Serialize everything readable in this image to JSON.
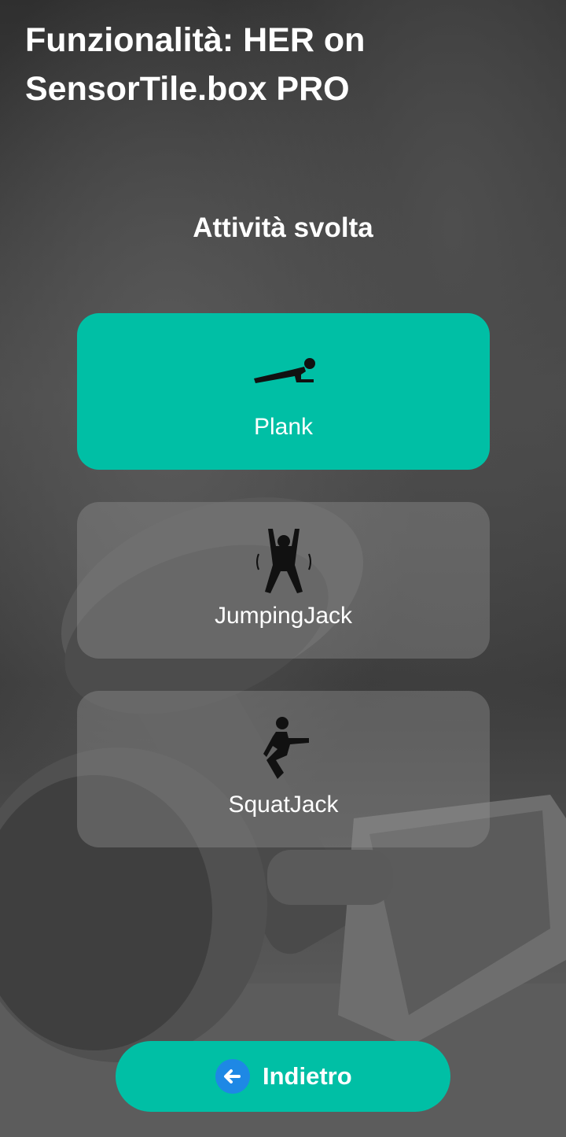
{
  "header": {
    "title_line1": "Funzionalità: HER on",
    "title_line2": "SensorTile.box PRO"
  },
  "section": {
    "title": "Attività svolta"
  },
  "activities": [
    {
      "label": "Plank",
      "icon": "plank-icon",
      "selected": true
    },
    {
      "label": "JumpingJack",
      "icon": "jumping-jack-icon",
      "selected": false
    },
    {
      "label": "SquatJack",
      "icon": "squat-jack-icon",
      "selected": false
    }
  ],
  "footer": {
    "back_label": "Indietro",
    "back_icon": "arrow-left-icon"
  },
  "colors": {
    "accent": "#00bfa5",
    "back_icon_bg": "#1e88e5",
    "inactive_card": "rgba(150,150,150,0.38)"
  }
}
